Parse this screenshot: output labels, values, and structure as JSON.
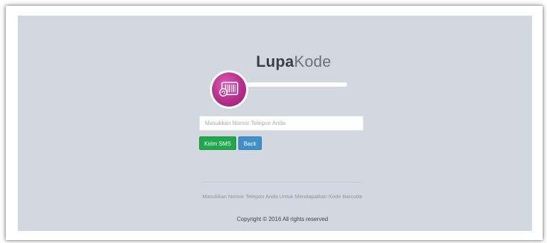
{
  "header": {
    "title_bold": "Lupa",
    "title_light": "Kode"
  },
  "logo": {
    "icon": "barcode-reset-icon",
    "color": "#b42f8c"
  },
  "form": {
    "phone_placeholder": "Masukkan Nomor Telepon Anda",
    "phone_value": ""
  },
  "buttons": {
    "send_sms_label": "Kirim SMS",
    "back_label": "Back",
    "send_sms_color": "#1fa84c",
    "back_color": "#3f8fca"
  },
  "footer": {
    "info_text": "Masukkan Nomor Telepon Anda Untuk Mendapatkan Kode Barcode",
    "copyright": "Copyright © 2016 All rights reserved"
  },
  "colors": {
    "panel_bg": "#d2d7e0"
  }
}
